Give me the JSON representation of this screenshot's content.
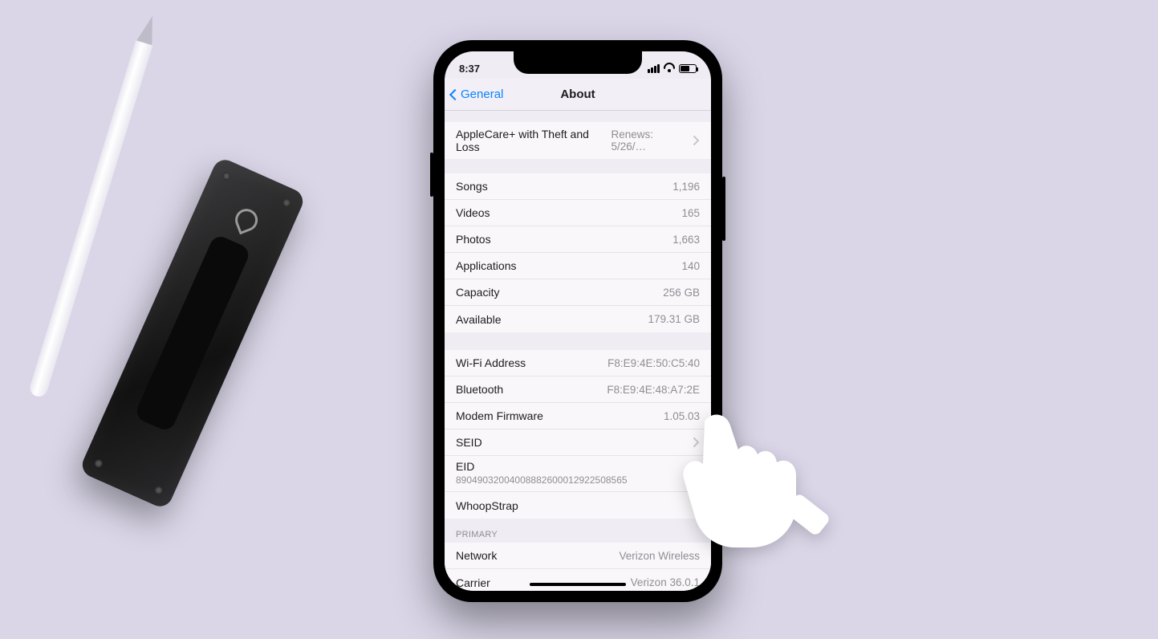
{
  "status": {
    "time": "8:37"
  },
  "nav": {
    "back_label": "General",
    "title": "About"
  },
  "applecare": {
    "label": "AppleCare+ with Theft and Loss",
    "value": "Renews: 5/26/…"
  },
  "counts": {
    "songs_label": "Songs",
    "songs_value": "1,196",
    "videos_label": "Videos",
    "videos_value": "165",
    "photos_label": "Photos",
    "photos_value": "1,663",
    "apps_label": "Applications",
    "apps_value": "140",
    "capacity_label": "Capacity",
    "capacity_value": "256 GB",
    "available_label": "Available",
    "available_value": "179.31 GB"
  },
  "addresses": {
    "wifi_label": "Wi-Fi Address",
    "wifi_value": "F8:E9:4E:50:C5:40",
    "bt_label": "Bluetooth",
    "bt_value": "F8:E9:4E:48:A7:2E",
    "modem_label": "Modem Firmware",
    "modem_value": "1.05.03",
    "seid_label": "SEID",
    "eid_label": "EID",
    "eid_value": "89049032004008882600012922508565",
    "accessory_label": "WhoopStrap"
  },
  "primary": {
    "header": "PRIMARY",
    "network_label": "Network",
    "network_value": "Verizon Wireless",
    "carrier_label": "Carrier",
    "carrier_value": "Verizon 36.0.1"
  }
}
